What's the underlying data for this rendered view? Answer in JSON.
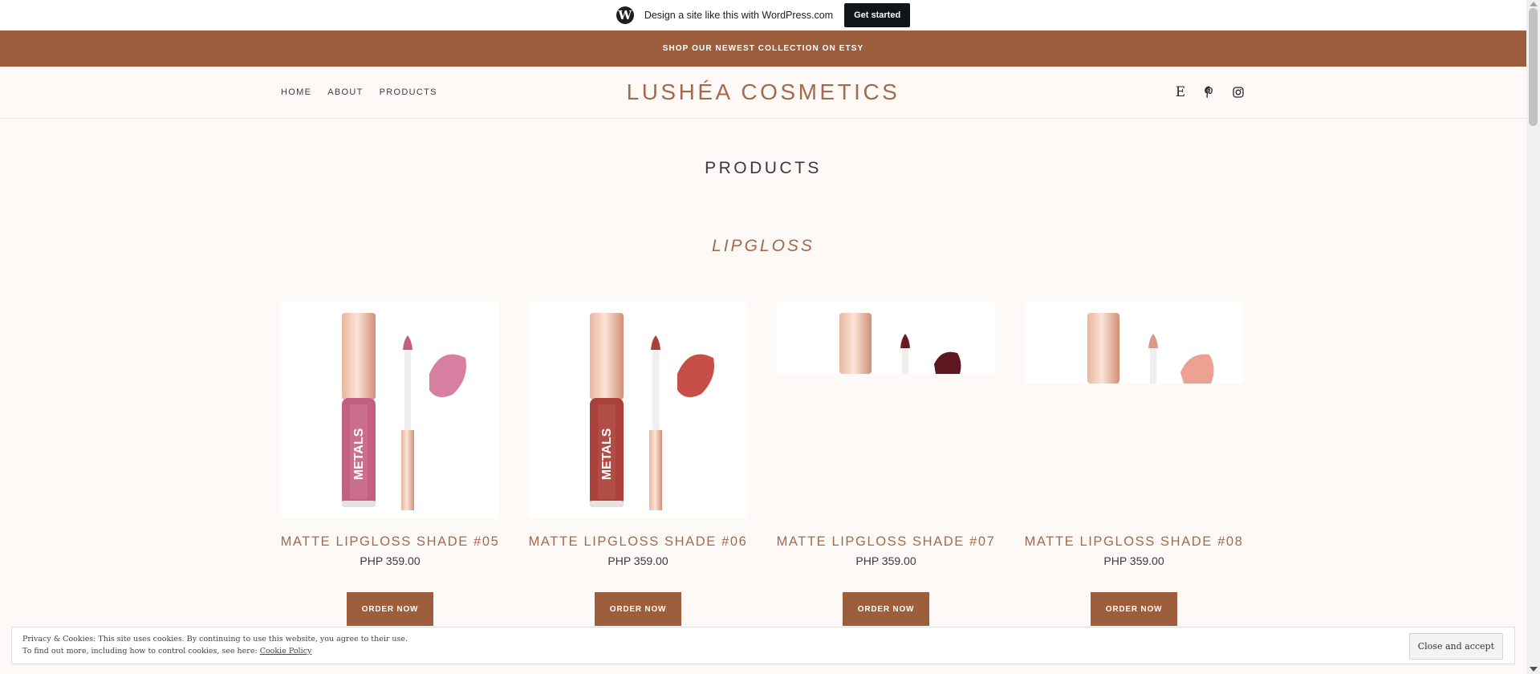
{
  "wpbar": {
    "logo": "W",
    "text": "Design a site like this with WordPress.com",
    "button": "Get started"
  },
  "promo": {
    "text": "SHOP OUR NEWEST COLLECTION ON ETSY"
  },
  "nav": {
    "items": [
      "HOME",
      "ABOUT",
      "PRODUCTS"
    ]
  },
  "site": {
    "title": "LUSHÉA COSMETICS"
  },
  "social": {
    "etsy": "E",
    "icons": [
      "etsy-icon",
      "pinterest-icon",
      "instagram-icon"
    ]
  },
  "page": {
    "title": "PRODUCTS"
  },
  "section": {
    "title": "LIPGLOSS"
  },
  "products": [
    {
      "name": "MATTE LIPGLOSS SHADE #05",
      "price": "PHP 359.00",
      "button": "ORDER NOW",
      "gloss_color": "#c4607f",
      "swatch_color": "#d77fa0"
    },
    {
      "name": "MATTE LIPGLOSS SHADE #06",
      "price": "PHP 359.00",
      "button": "ORDER NOW",
      "gloss_color": "#a9413a",
      "swatch_color": "#c64f47"
    },
    {
      "name": "MATTE LIPGLOSS SHADE #07",
      "price": "PHP 359.00",
      "button": "ORDER NOW",
      "gloss_color": "#6b1a22",
      "swatch_color": "#5e1620"
    },
    {
      "name": "MATTE LIPGLOSS SHADE #08",
      "price": "PHP 359.00",
      "button": "ORDER NOW",
      "gloss_color": "#d79a86",
      "swatch_color": "#eda190"
    }
  ],
  "cookie": {
    "line1": "Privacy & Cookies: This site uses cookies. By continuing to use this website, you agree to their use.",
    "line2": "To find out more, including how to control cookies, see here:",
    "link": "Cookie Policy",
    "button": "Close and accept"
  },
  "colors": {
    "accent": "#9c5e3d",
    "title": "#a56a4a",
    "background": "#fdf9f6"
  }
}
